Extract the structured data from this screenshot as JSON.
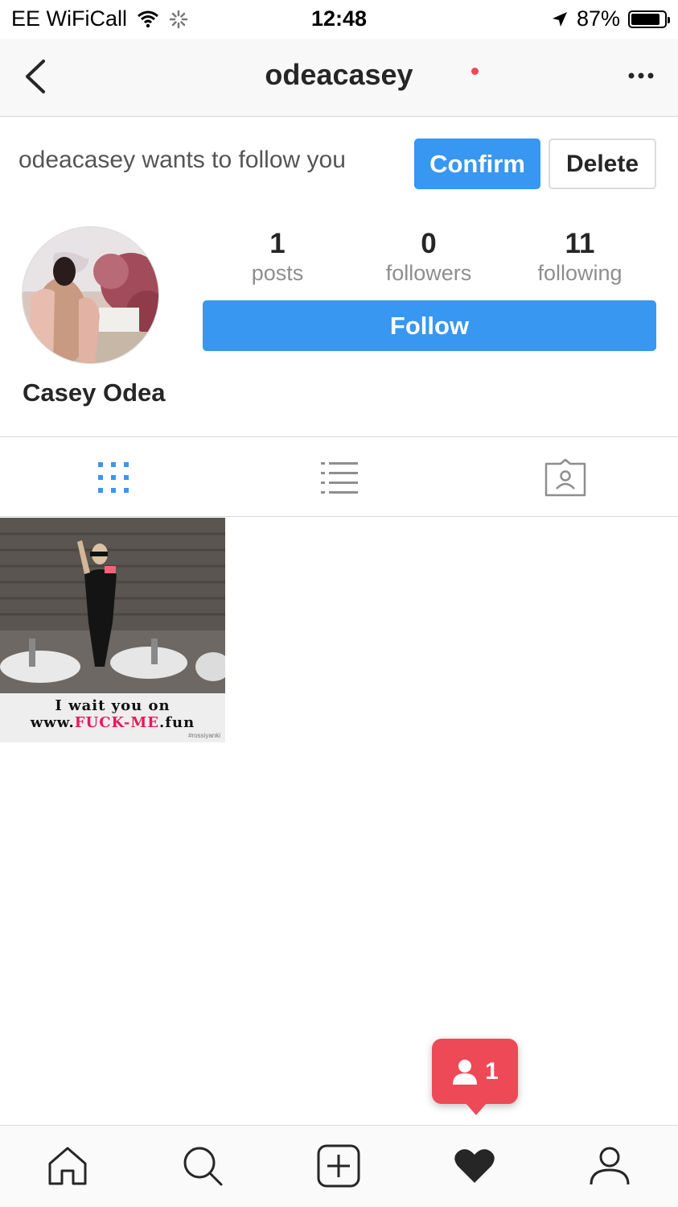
{
  "status_bar": {
    "carrier": "EE WiFiCall",
    "time": "12:48",
    "battery_percent": "87%",
    "battery_level": 0.87
  },
  "nav": {
    "title": "odeacasey"
  },
  "follow_request": {
    "text": "odeacasey wants to follow you",
    "confirm_label": "Confirm",
    "delete_label": "Delete"
  },
  "profile": {
    "display_name": "Casey Odea",
    "stats": [
      {
        "count": "1",
        "label": "posts"
      },
      {
        "count": "0",
        "label": "followers"
      },
      {
        "count": "11",
        "label": "following"
      }
    ],
    "follow_label": "Follow"
  },
  "post": {
    "caption_line1": "I wait you on",
    "caption_prefix": "www.",
    "caption_highlight": "FUCK-ME",
    "caption_suffix": ".fun",
    "watermark": "#rossiyanki"
  },
  "notification": {
    "count": "1"
  },
  "colors": {
    "accent": "#3897f0",
    "notification": "#ed4956",
    "text": "#262626",
    "muted": "#8e8e8e"
  },
  "icons": [
    "wifi-icon",
    "loading-icon",
    "location-arrow-icon",
    "battery-icon",
    "back-chevron-icon",
    "more-icon",
    "grid-icon",
    "list-icon",
    "tagged-icon",
    "person-icon",
    "home-icon",
    "search-icon",
    "add-icon",
    "heart-icon",
    "profile-icon"
  ]
}
